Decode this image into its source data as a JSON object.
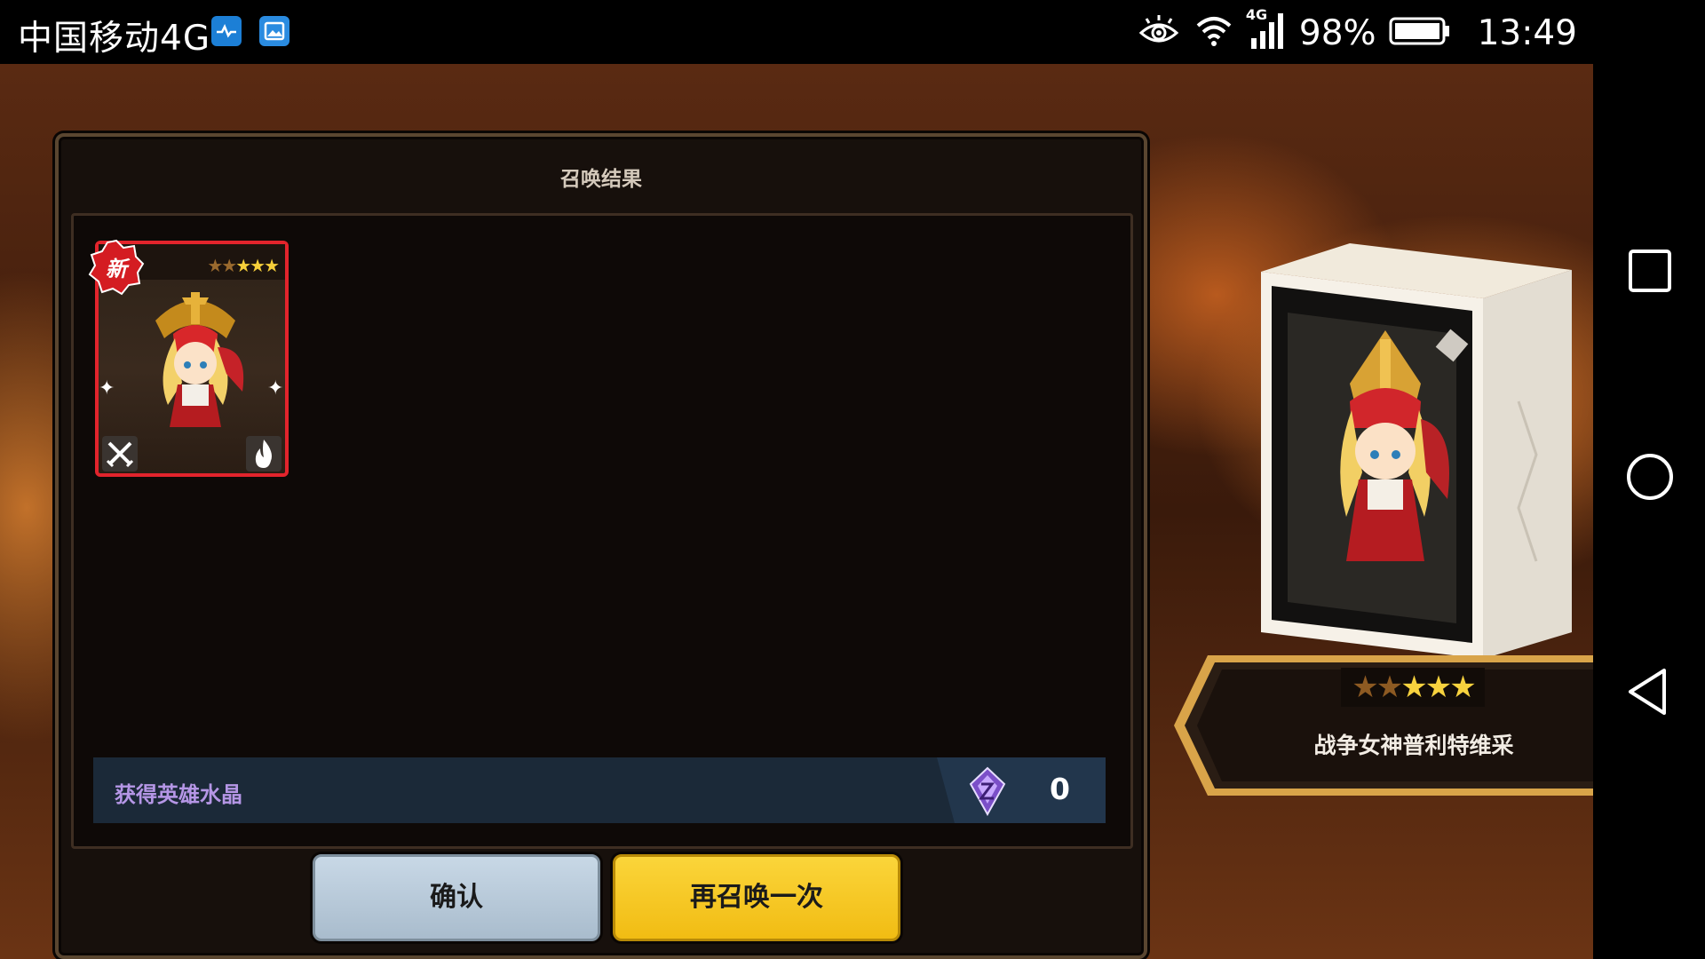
{
  "status_bar": {
    "carrier": "中国移动4G",
    "network_badge": "4G",
    "battery": "98%",
    "time": "13:49",
    "icons": [
      "health-app-icon",
      "gallery-app-icon",
      "eye-comfort-icon",
      "wifi-icon",
      "cell-signal-icon",
      "battery-icon"
    ]
  },
  "dialog": {
    "title": "召唤结果",
    "hero_card": {
      "new_badge": "新",
      "stars_total": 5,
      "stars_lit": 3,
      "class_icon": "swords-icon",
      "element_icon": "fire-icon"
    },
    "crystal": {
      "label": "获得英雄水晶",
      "count": "0",
      "icon": "hero-crystal-icon"
    },
    "buttons": {
      "confirm": "确认",
      "summon_again": "再召唤一次"
    }
  },
  "hero_display": {
    "stars_total": 5,
    "stars_lit": 3,
    "name": "战争女神普利特维采"
  },
  "nav_bar": {
    "buttons": [
      "recent-apps-button",
      "home-button",
      "back-button"
    ]
  },
  "colors": {
    "card_border": "#e2242c",
    "summon_again_button": "#f6c51f",
    "confirm_button": "#b9cbdb",
    "crystal_label": "#b596e6"
  }
}
